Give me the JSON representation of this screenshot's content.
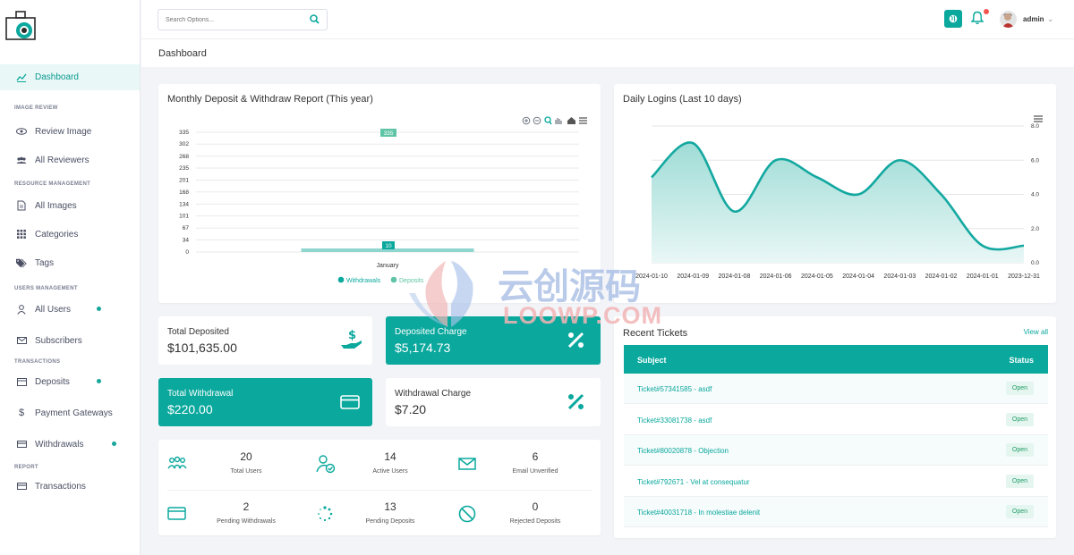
{
  "topbar": {
    "search_placeholder": "Search Options...",
    "user_name": "admin"
  },
  "page": {
    "title": "Dashboard"
  },
  "sidebar": {
    "items": [
      {
        "label": "Dashboard"
      },
      {
        "section": "IMAGE REVIEW"
      },
      {
        "label": "Review Image"
      },
      {
        "label": "All Reviewers"
      },
      {
        "section": "RESOURCE MANAGEMENT"
      },
      {
        "label": "All Images"
      },
      {
        "label": "Categories"
      },
      {
        "label": "Tags"
      },
      {
        "section": "USERS MANAGEMENT"
      },
      {
        "label": "All Users"
      },
      {
        "label": "Subscribers"
      },
      {
        "section": "TRANSACTIONS"
      },
      {
        "label": "Deposits"
      },
      {
        "label": "Payment Gateways"
      },
      {
        "label": "Withdrawals"
      },
      {
        "section": "REPORT"
      },
      {
        "label": "Transactions"
      }
    ]
  },
  "deposit_chart": {
    "title": "Monthly Deposit & Withdraw Report (This year)",
    "y_ticks": [
      "335",
      "302",
      "268",
      "235",
      "201",
      "168",
      "134",
      "101",
      "67",
      "34",
      "0"
    ],
    "category": "January",
    "max_label": "335",
    "bar_label": "10",
    "legend": [
      "Withdrawals",
      "Deposits"
    ]
  },
  "logins_chart": {
    "title": "Daily Logins (Last 10 days)",
    "y_ticks": [
      "8.0",
      "6.0",
      "4.0",
      "2.0",
      "0.0"
    ],
    "x_labels": [
      "2024-01-10",
      "2024-01-09",
      "2024-01-08",
      "2024-01-06",
      "2024-01-05",
      "2024-01-04",
      "2024-01-03",
      "2024-01-02",
      "2024-01-01",
      "2023-12-31"
    ]
  },
  "chart_data": [
    {
      "type": "bar",
      "title": "Monthly Deposit & Withdraw Report (This year)",
      "categories": [
        "January"
      ],
      "series": [
        {
          "name": "Withdrawals",
          "values": [
            10
          ]
        },
        {
          "name": "Deposits",
          "values": [
            335
          ]
        }
      ],
      "ylim": [
        0,
        335
      ],
      "legend": "bottom"
    },
    {
      "type": "area",
      "title": "Daily Logins (Last 10 days)",
      "x": [
        "2024-01-10",
        "2024-01-09",
        "2024-01-08",
        "2024-01-06",
        "2024-01-05",
        "2024-01-04",
        "2024-01-03",
        "2024-01-02",
        "2024-01-01",
        "2023-12-31"
      ],
      "series": [
        {
          "values": [
            5,
            7,
            3,
            6,
            5,
            4,
            6,
            4,
            1,
            1
          ]
        }
      ],
      "ylim": [
        0,
        8
      ]
    }
  ],
  "stats": {
    "total_deposited": {
      "label": "Total Deposited",
      "value": "$101,635.00"
    },
    "deposited_charge": {
      "label": "Deposited Charge",
      "value": "$5,174.73"
    },
    "total_withdrawal": {
      "label": "Total Withdrawal",
      "value": "$220.00"
    },
    "withdrawal_charge": {
      "label": "Withdrawal Charge",
      "value": "$7.20"
    }
  },
  "summary": [
    {
      "value": "20",
      "label": "Total Users"
    },
    {
      "value": "14",
      "label": "Active Users"
    },
    {
      "value": "6",
      "label": "Email Unverified"
    },
    {
      "value": "2",
      "label": "Pending Withdrawals"
    },
    {
      "value": "13",
      "label": "Pending Deposits"
    },
    {
      "value": "0",
      "label": "Rejected Deposits"
    }
  ],
  "tickets": {
    "title": "Recent Tickets",
    "view_all": "View all",
    "headers": [
      "Subject",
      "Status"
    ],
    "rows": [
      {
        "subject": "Ticket#57341585 - asdf",
        "status": "Open"
      },
      {
        "subject": "Ticket#33081738 - asdf",
        "status": "Open"
      },
      {
        "subject": "Ticket#80020878 - Objection",
        "status": "Open"
      },
      {
        "subject": "Ticket#792671 - Vel at consequatur",
        "status": "Open"
      },
      {
        "subject": "Ticket#40031718 - In molestiae delenit",
        "status": "Open"
      }
    ]
  },
  "watermark": {
    "cn": "云创源码",
    "en": "LOOWP.COM"
  },
  "colors": {
    "accent": "#0aa89d",
    "badge_bg": "#e5f6f0",
    "alert": "#f0544f"
  }
}
